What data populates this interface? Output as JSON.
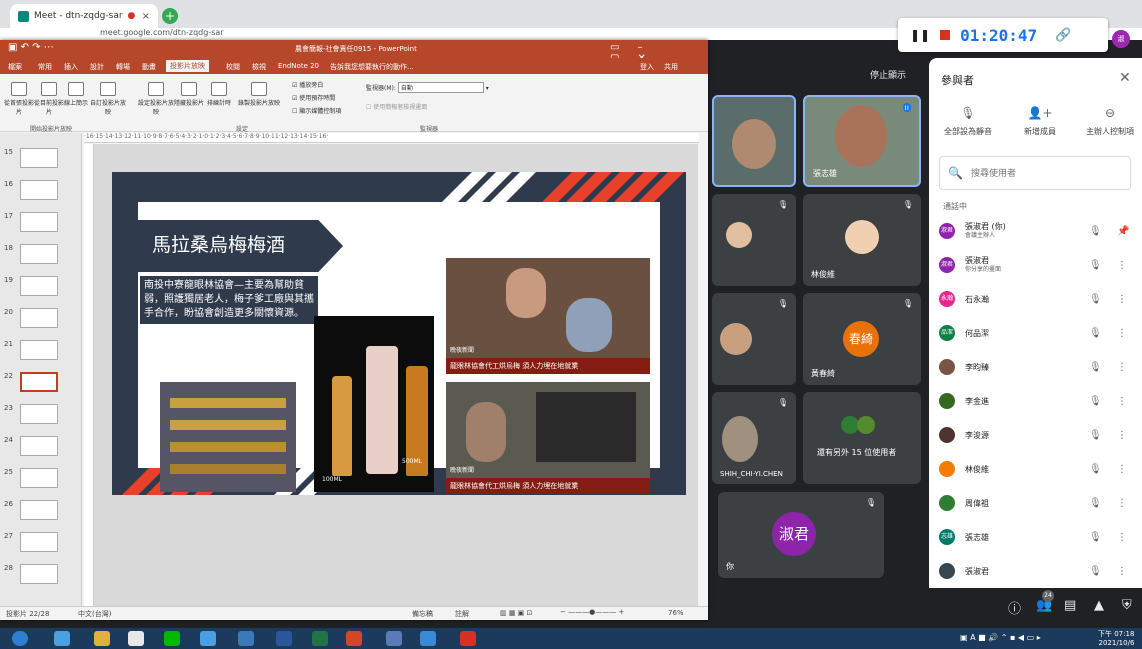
{
  "browser": {
    "tab_title": "Meet - dtn-zqdg-sar",
    "url": "meet.google.com/dtn-zqdg-sar"
  },
  "meet": {
    "timer": "01:20:47",
    "stop_presenting": "停止顯示",
    "tiles": [
      {
        "name": "張志雄"
      },
      {
        "name": "林俊維"
      },
      {
        "name": "黃春綺",
        "initials": "春綺",
        "color": "#e8710a"
      },
      {
        "name": "SHIH_CHI-YI.CHEN"
      },
      {
        "name": "還有另外 15 位使用者"
      },
      {
        "name": "你",
        "initials": "淑君",
        "color": "#8e24aa"
      }
    ],
    "participants_panel": {
      "title": "參與者",
      "mute_all": "全部設為靜音",
      "add_people": "新增成員",
      "host_controls": "主辦人控制項",
      "search_placeholder": "搜尋使用者",
      "section": "通話中",
      "people": [
        {
          "name": "張淑君 (你)",
          "sub": "會議主辦人",
          "initials": "淑君",
          "color": "#8e24aa"
        },
        {
          "name": "張淑君",
          "sub": "你分享的畫面",
          "initials": "淑君",
          "color": "#8e24aa"
        },
        {
          "name": "石永瀚",
          "sub": "",
          "initials": "永瀚",
          "color": "#e52592"
        },
        {
          "name": "何品潔",
          "sub": "",
          "initials": "品潔",
          "color": "#0b8043"
        },
        {
          "name": "李昀臻",
          "sub": "",
          "initials": "",
          "color": "#795548"
        },
        {
          "name": "李金進",
          "sub": "",
          "initials": "",
          "color": "#33691e"
        },
        {
          "name": "李浚源",
          "sub": "",
          "initials": "",
          "color": "#4e342e"
        },
        {
          "name": "林俊維",
          "sub": "",
          "initials": "",
          "color": "#f57c00"
        },
        {
          "name": "周偉祖",
          "sub": "",
          "initials": "",
          "color": "#2e7d32"
        },
        {
          "name": "張志雄",
          "sub": "",
          "initials": "志雄",
          "color": "#00796b"
        },
        {
          "name": "張淑君",
          "sub": "",
          "initials": "",
          "color": "#37474f"
        }
      ],
      "participant_count": "24"
    }
  },
  "ppt": {
    "window_title": "農會簡報-社會責任0915 - PowerPoint",
    "menu_tabs": [
      "檔案",
      "常用",
      "插入",
      "設計",
      "轉場",
      "動畫",
      "投影片放映",
      "校閱",
      "檢視",
      "EndNote 20"
    ],
    "tell_me": "告訴我您想要執行的動作...",
    "login": "登入",
    "share": "共用",
    "ribbon": {
      "from_beginning": "從首張投影片",
      "from_current": "從目前投影片",
      "online": "線上簡示",
      "custom": "自訂投影片放映",
      "setup": "設定投影片放映",
      "hide": "隱藏投影片",
      "rehearse": "排練計時",
      "record": "錄製投影片放映",
      "opt_narration": "播放旁白",
      "opt_timings": "使用預存時間",
      "opt_media": "顯示媒體控制項",
      "monitor_label": "監視器(M):",
      "monitor_value": "自動",
      "presenter_view": "使用簡報者檢視畫面",
      "group_start": "開始投影片放映",
      "group_setup": "設定",
      "group_monitor": "監視器"
    },
    "ruler_text": "·16·15·14·13·12·11·10·9·8·7·6·5·4·3·2·1·0·1·2·3·4·5·6·7·8·9·10·11·12·13·14·15·16·",
    "thumbs": [
      "15",
      "16",
      "17",
      "18",
      "19",
      "20",
      "21",
      "22",
      "23",
      "24",
      "25",
      "26",
      "27",
      "28"
    ],
    "status": {
      "slide_count": "投影片 22/28",
      "language": "中文(台灣)",
      "notes": "備忘稿",
      "comments": "註解",
      "zoom": "76%"
    }
  },
  "slide": {
    "title": "馬拉桑烏梅梅酒",
    "body": "南投中寮龍眼林協會—主要為幫助貧弱，照護獨居老人，梅子爹工廠與其攜手合作，盼協會創造更多關懷資源。",
    "caption1": "龍眼林協會代工烘烏梅 須人力埋在地就業",
    "caption2": "龍眼林協會代工烘烏梅 須人力埋在地就業",
    "news_logo": "晚夜新聞",
    "bottle_label1": "100ML",
    "bottle_label2": "500ML"
  },
  "taskbar": {
    "time": "下午 07:18",
    "date": "2021/10/6"
  }
}
